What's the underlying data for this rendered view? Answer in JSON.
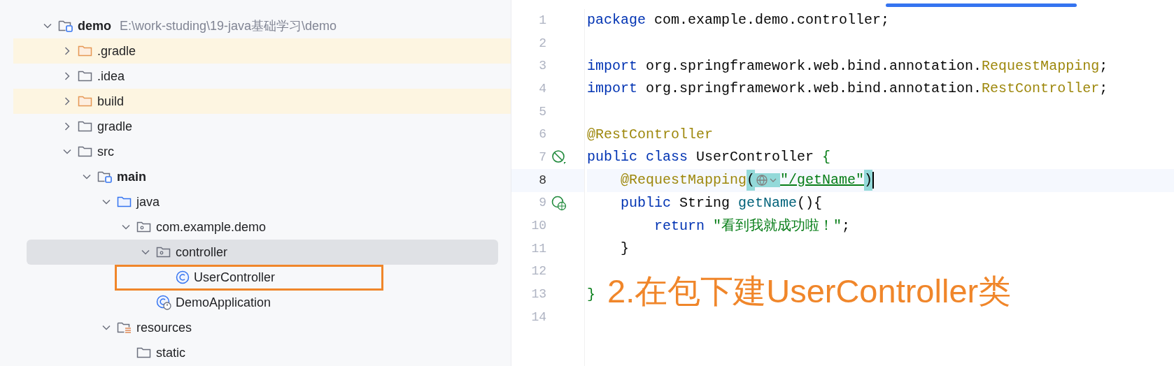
{
  "project_tree": [
    {
      "kind": "module",
      "label": "demo",
      "path": "E:\\work-studing\\19-java基础学习\\demo",
      "expanded": true,
      "highlighted": false,
      "selected": false,
      "children": [
        {
          "kind": "excluded",
          "label": ".gradle",
          "expanded": false,
          "highlighted": true,
          "selected": false
        },
        {
          "kind": "folder",
          "label": ".idea",
          "expanded": false,
          "highlighted": false,
          "selected": false
        },
        {
          "kind": "excluded",
          "label": "build",
          "expanded": false,
          "highlighted": true,
          "selected": false
        },
        {
          "kind": "folder",
          "label": "gradle",
          "expanded": false,
          "highlighted": false,
          "selected": false
        },
        {
          "kind": "folder",
          "label": "src",
          "expanded": true,
          "highlighted": false,
          "selected": false,
          "children": [
            {
              "kind": "module",
              "label": "main",
              "expanded": true,
              "highlighted": false,
              "selected": false,
              "children": [
                {
                  "kind": "source",
                  "label": "java",
                  "expanded": true,
                  "highlighted": false,
                  "selected": false,
                  "children": [
                    {
                      "kind": "package",
                      "label": "com.example.demo",
                      "expanded": true,
                      "highlighted": false,
                      "selected": false,
                      "children": [
                        {
                          "kind": "package",
                          "label": "controller",
                          "expanded": true,
                          "highlighted": false,
                          "selected": true,
                          "children": [
                            {
                              "kind": "class",
                              "label": "UserController",
                              "highlighted": false,
                              "selected": false
                            }
                          ]
                        },
                        {
                          "kind": "app",
                          "label": "DemoApplication",
                          "highlighted": false,
                          "selected": false
                        }
                      ]
                    }
                  ]
                },
                {
                  "kind": "resources",
                  "label": "resources",
                  "expanded": true,
                  "highlighted": false,
                  "selected": false,
                  "children": [
                    {
                      "kind": "folder",
                      "label": "static",
                      "highlighted": false,
                      "selected": false
                    }
                  ]
                }
              ]
            }
          ]
        }
      ]
    }
  ],
  "editor": {
    "lines": [
      {
        "number": "1",
        "kind": "code",
        "current": false,
        "tokens": [
          {
            "kind": "keyword",
            "text": "package"
          },
          {
            "kind": "plain",
            "text": " com.example.demo.controller;"
          }
        ]
      },
      {
        "number": "2",
        "kind": "code",
        "current": false
      },
      {
        "number": "3",
        "kind": "code",
        "current": false,
        "tokens": [
          {
            "kind": "keyword",
            "text": "import"
          },
          {
            "kind": "plain",
            "text": " org.springframework.web.bind.annotation."
          },
          {
            "kind": "annotation",
            "text": "RequestMapping"
          },
          {
            "kind": "plain",
            "text": ";"
          }
        ]
      },
      {
        "number": "4",
        "kind": "code",
        "current": false,
        "tokens": [
          {
            "kind": "keyword",
            "text": "import"
          },
          {
            "kind": "plain",
            "text": " org.springframework.web.bind.annotation."
          },
          {
            "kind": "annotation",
            "text": "RestController"
          },
          {
            "kind": "plain",
            "text": ";"
          }
        ]
      },
      {
        "number": "5",
        "kind": "code",
        "current": false
      },
      {
        "number": "6",
        "kind": "code",
        "current": false,
        "tokens": [
          {
            "kind": "annotation",
            "text": "@RestController"
          }
        ]
      },
      {
        "number": "7",
        "kind": "bean",
        "current": false,
        "tokens": [
          {
            "kind": "keyword",
            "text": "public class"
          },
          {
            "kind": "plain",
            "text": " UserController "
          },
          {
            "kind": "string",
            "text": "{"
          }
        ]
      },
      {
        "number": "8",
        "kind": "code",
        "current": true,
        "tokens": [
          {
            "kind": "annotation",
            "text": "    @RequestMapping"
          },
          {
            "kind": "bracket",
            "text": "("
          },
          {
            "kind": "inlay"
          },
          {
            "kind": "link",
            "text": "\"/getName\""
          },
          {
            "kind": "bracket",
            "text": ")"
          },
          {
            "kind": "caret"
          }
        ]
      },
      {
        "number": "9",
        "kind": "endpoint",
        "current": false,
        "tokens": [
          {
            "kind": "keyword",
            "text": "    public"
          },
          {
            "kind": "plain",
            "text": " String "
          },
          {
            "kind": "method",
            "text": "getName"
          },
          {
            "kind": "plain",
            "text": "(){"
          }
        ]
      },
      {
        "number": "10",
        "kind": "code",
        "current": false,
        "tokens": [
          {
            "kind": "keyword",
            "text": "        return"
          },
          {
            "kind": "string",
            "text": " \"看到我就成功啦！\""
          },
          {
            "kind": "plain",
            "text": ";"
          }
        ]
      },
      {
        "number": "11",
        "kind": "code",
        "current": false,
        "tokens": [
          {
            "kind": "plain",
            "text": "    }"
          }
        ]
      },
      {
        "number": "12",
        "kind": "code",
        "current": false
      },
      {
        "number": "13",
        "kind": "code",
        "current": false,
        "tokens": [
          {
            "kind": "string",
            "text": "}"
          }
        ]
      },
      {
        "number": "14",
        "kind": "code",
        "current": false
      }
    ]
  },
  "annotation": {
    "text": "2.在包下建UserController类"
  }
}
